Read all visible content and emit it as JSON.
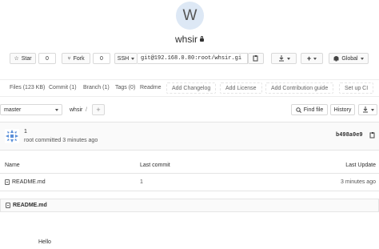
{
  "project": {
    "avatar_letter": "W",
    "name": "whsir"
  },
  "actions": {
    "star_label": "Star",
    "star_count": "0",
    "fork_label": "Fork",
    "fork_count": "0",
    "protocol": "SSH",
    "clone_url": "git@192.168.0.80:root/whsir.gi",
    "notification_level": "Global"
  },
  "stats": {
    "files": "Files (123 KB)",
    "commits": "Commit (1)",
    "branches": "Branch (1)",
    "tags": "Tags (0)",
    "readme": "Readme",
    "add_changelog": "Add Changelog",
    "add_license": "Add License",
    "add_contribution": "Add Contribution guide",
    "setup_ci": "Set up CI"
  },
  "nav": {
    "branch": "master",
    "breadcrumb_root": "whsir",
    "breadcrumb_sep": "/",
    "add_icon": "+",
    "find_file": "Find file",
    "history": "History"
  },
  "last_commit": {
    "title": "1",
    "meta": "root committed 3 minutes ago",
    "sha": "b498a0e9"
  },
  "file_table": {
    "headers": [
      "Name",
      "Last commit",
      "Last Update"
    ],
    "rows": [
      {
        "name": "README.md",
        "last_commit": "1",
        "last_update": "3 minutes ago"
      }
    ]
  },
  "readme": {
    "filename": "README.md",
    "content": "Hello"
  },
  "colors": {
    "avatar_bg": "#dde8f5",
    "identicon": "#5a8fd8"
  }
}
